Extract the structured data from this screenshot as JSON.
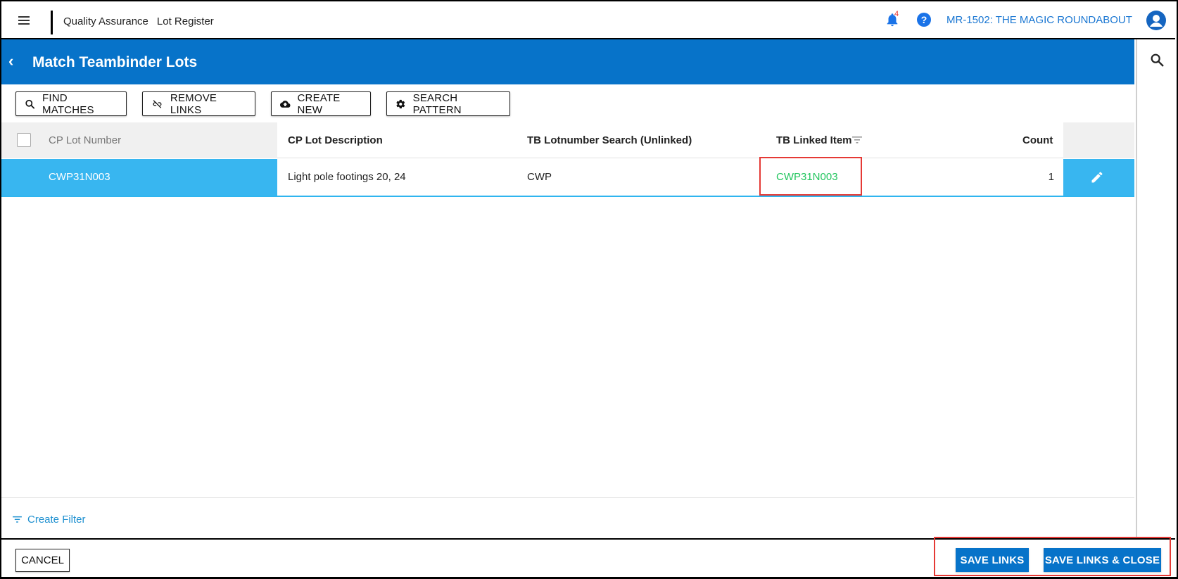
{
  "topbar": {
    "breadcrumb": [
      "Quality Assurance",
      "Lot Register"
    ],
    "notification_count": "4",
    "help_glyph": "?",
    "project": "MR-1502: THE MAGIC ROUNDABOUT"
  },
  "header": {
    "title": "Match Teambinder Lots",
    "back_glyph": "‹"
  },
  "toolbar": {
    "find_matches": "FIND MATCHES",
    "remove_links": "REMOVE LINKS",
    "create_new": "CREATE NEW",
    "search_pattern": "SEARCH PATTERN"
  },
  "grid": {
    "columns": {
      "cp_lot_number": "CP Lot Number",
      "cp_lot_description": "CP Lot Description",
      "tb_lotnumber_search": "TB Lotnumber Search (Unlinked)",
      "tb_linked_item": "TB Linked Item",
      "count": "Count"
    },
    "rows": [
      {
        "cp_lot_number": "CWP31N003",
        "cp_lot_description": "Light pole footings 20, 24",
        "tb_lotnumber_search": "CWP",
        "tb_linked_item": "CWP31N003",
        "count": "1"
      }
    ],
    "create_filter": "Create Filter"
  },
  "footer": {
    "cancel": "CANCEL",
    "save_links": "SAVE LINKS",
    "save_links_close": "SAVE LINKS & CLOSE"
  },
  "colors": {
    "brand_blue": "#0773c9",
    "selected_row": "#38b6f0",
    "linked_item_green": "#22c55e",
    "annotation_red": "#e53935"
  },
  "icons": [
    "menu-icon",
    "bell-icon",
    "help-icon",
    "account-icon",
    "search-icon",
    "link-off-icon",
    "cloud-upload-icon",
    "gear-icon",
    "filter-icon",
    "pencil-icon",
    "chevron-left-icon"
  ]
}
